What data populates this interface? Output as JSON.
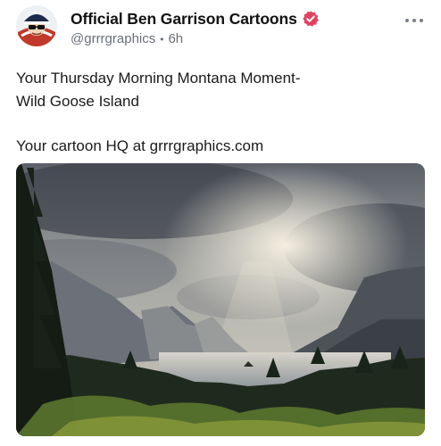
{
  "post": {
    "author_name": "Official  Ben Garrison Cartoons",
    "handle": "@grrrgraphics",
    "separator": "•",
    "time": "6h",
    "text_lines": [
      "Your Thursday Morning Montana Moment-",
      "Wild Goose Island"
    ],
    "promo": "Your cartoon HQ at grrrgraphics.com"
  },
  "icons": {
    "avatar": "cartoon-avatar-icon",
    "verified": "verified-badge-icon",
    "more": "more-options-icon"
  },
  "colors": {
    "verified_badge": "#e4405f",
    "text": "#1a1a1a",
    "meta": "#6b7077"
  }
}
